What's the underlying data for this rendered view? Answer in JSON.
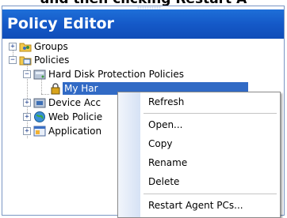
{
  "top_caption": "and then clicking Restart A",
  "panel": {
    "title": "Policy Editor"
  },
  "tree": {
    "items": [
      {
        "label": "Groups",
        "expander": "+"
      },
      {
        "label": "Policies",
        "expander": "−"
      },
      {
        "label": "Hard Disk Protection Policies",
        "expander": "−"
      },
      {
        "label": "My Har",
        "selected": true
      },
      {
        "label": "Device Acc",
        "expander": "+"
      },
      {
        "label": "Web Policie",
        "expander": "+"
      },
      {
        "label": "Application",
        "expander": "+"
      }
    ]
  },
  "context_menu": {
    "items": [
      "Refresh",
      "Open...",
      "Copy",
      "Rename",
      "Delete",
      "Restart Agent PCs..."
    ]
  },
  "colors": {
    "title_bar": "#1559c8",
    "selection": "#316ac5"
  }
}
